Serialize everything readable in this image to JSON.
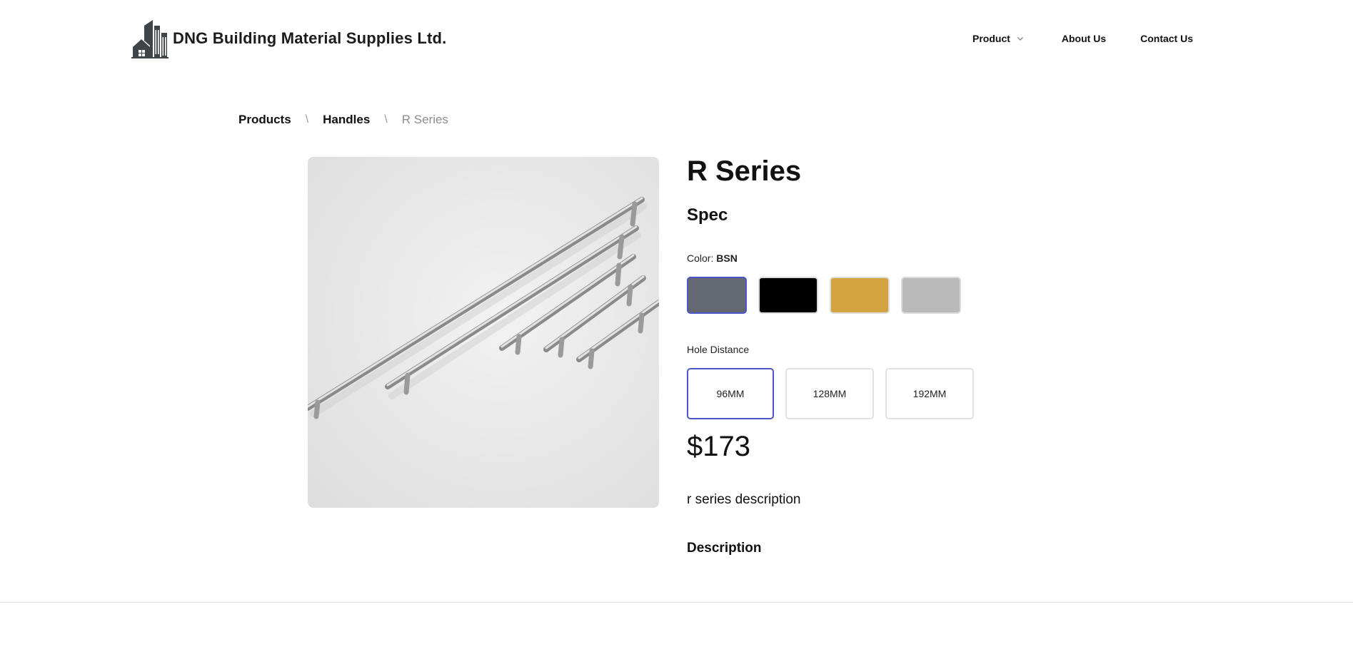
{
  "header": {
    "brand_name": "DNG Building Material Supplies Ltd.",
    "logo_icon": "building-logo-icon",
    "nav": [
      {
        "label": "Product",
        "has_dropdown": true
      },
      {
        "label": "About Us"
      },
      {
        "label": "Contact Us"
      }
    ]
  },
  "breadcrumb": {
    "items": [
      "Products",
      "Handles"
    ],
    "separator": "\\",
    "current": "R Series"
  },
  "product": {
    "title": "R Series",
    "spec_heading": "Spec",
    "color_label": "Color",
    "color_selected": "BSN",
    "colors": [
      {
        "hex": "#646a6f",
        "selected": true
      },
      {
        "hex": "#000000",
        "selected": false
      },
      {
        "hex": "#d1a43f",
        "selected": false
      },
      {
        "hex": "#b9b9b9",
        "selected": false
      }
    ],
    "hole_label": "Hole Distance",
    "hole_options": [
      {
        "label": "96MM",
        "selected": true
      },
      {
        "label": "128MM",
        "selected": false
      },
      {
        "label": "192MM",
        "selected": false
      }
    ],
    "price": "$173",
    "short_description": "r series description",
    "description_heading": "Description"
  },
  "colors": {
    "accent": "#4a56c7",
    "text": "#111111",
    "muted": "#8c8c8c"
  }
}
